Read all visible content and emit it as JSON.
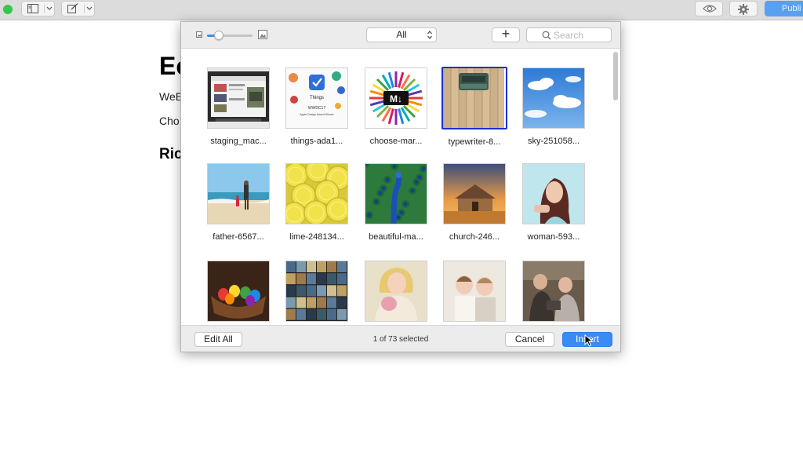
{
  "toolbar": {
    "publish_label": "Publi",
    "accent_color": "#5aa0f0",
    "icons": [
      "sidebar-icon",
      "chevron-down-icon",
      "compose-icon",
      "chevron-down-icon",
      "eye-icon",
      "gear-icon"
    ]
  },
  "document": {
    "title": "Ec",
    "paragraph_1": "WeE",
    "paragraph_2": "Cho",
    "heading_2": "Rict"
  },
  "dialog": {
    "zoom_level": 0.25,
    "filter_value": "All",
    "add_label": "+",
    "search_placeholder": "Search",
    "items": [
      {
        "label": "staging_mac...",
        "selected": false,
        "art": "screenshot"
      },
      {
        "label": "things-ada1...",
        "selected": false,
        "art": "things"
      },
      {
        "label": "choose-mar...",
        "selected": false,
        "art": "markdown"
      },
      {
        "label": "typewriter-8...",
        "selected": true,
        "art": "typewriter"
      },
      {
        "label": "sky-251058...",
        "selected": false,
        "art": "sky"
      },
      {
        "label": "father-6567...",
        "selected": false,
        "art": "beach"
      },
      {
        "label": "lime-248134...",
        "selected": false,
        "art": "lime"
      },
      {
        "label": "beautiful-ma...",
        "selected": false,
        "art": "peacock"
      },
      {
        "label": "church-246...",
        "selected": false,
        "art": "church"
      },
      {
        "label": "woman-593...",
        "selected": false,
        "art": "woman"
      },
      {
        "label": "",
        "selected": false,
        "art": "eggs"
      },
      {
        "label": "",
        "selected": false,
        "art": "building"
      },
      {
        "label": "",
        "selected": false,
        "art": "girl"
      },
      {
        "label": "",
        "selected": false,
        "art": "kids"
      },
      {
        "label": "",
        "selected": false,
        "art": "family"
      }
    ],
    "things_text": "Things",
    "things_event": "WWDC17",
    "things_award": "Apple Design Award Winner",
    "markdown_text": "M↓",
    "edit_all_label": "Edit All",
    "status_text": "1 of 73 selected",
    "cancel_label": "Cancel",
    "insert_label": "Insert",
    "selection_color": "#1b2fd6",
    "primary_color": "#3a8bf5"
  }
}
